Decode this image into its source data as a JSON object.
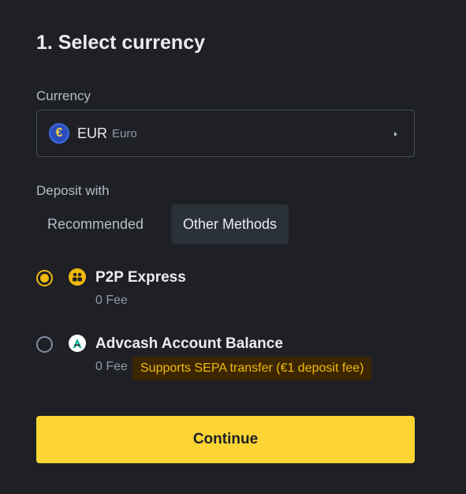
{
  "section": {
    "title": "1. Select currency"
  },
  "currency": {
    "label": "Currency",
    "selected_code": "EUR",
    "selected_name": "Euro",
    "icon_symbol": "€",
    "icon": "euro-coin-icon"
  },
  "deposit": {
    "label": "Deposit with",
    "tabs": [
      {
        "label": "Recommended",
        "active": false
      },
      {
        "label": "Other Methods",
        "active": true
      }
    ]
  },
  "methods": [
    {
      "name": "P2P Express",
      "fee": "0 Fee",
      "selected": true,
      "icon": "p2p-express-icon"
    },
    {
      "name": "Advcash Account Balance",
      "fee": "0 Fee",
      "badge": "Supports SEPA transfer (€1 deposit fee)",
      "selected": false,
      "icon": "advcash-icon"
    }
  ],
  "actions": {
    "continue_label": "Continue"
  },
  "colors": {
    "background": "#1e2026",
    "accent": "#fcd535",
    "radio_selected": "#f0b90b",
    "badge_bg": "#3c2601",
    "badge_text": "#f0b90b"
  }
}
